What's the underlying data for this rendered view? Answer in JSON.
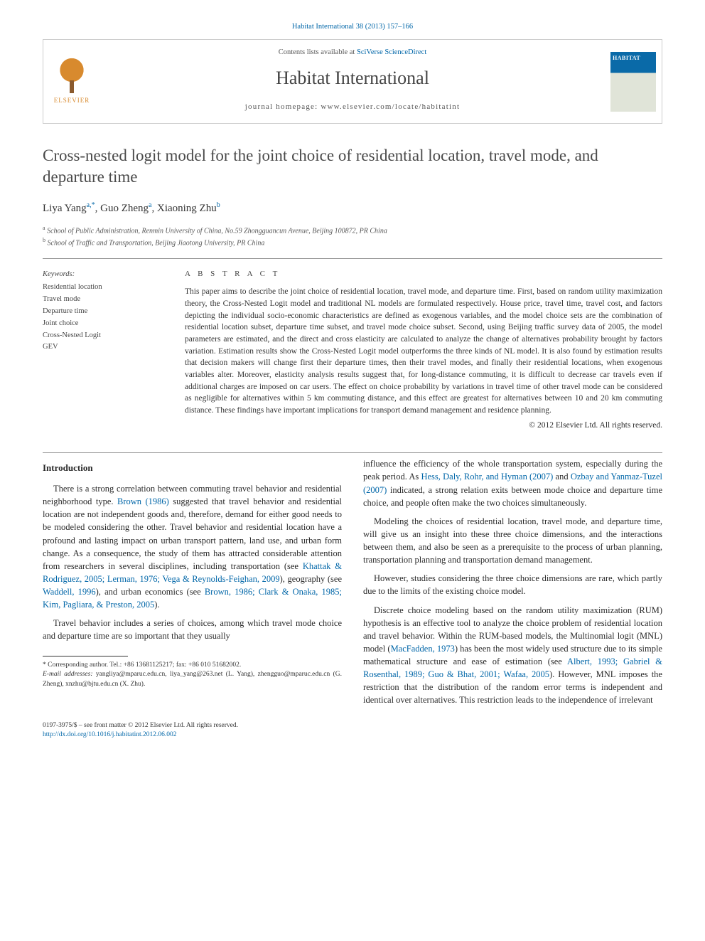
{
  "citation": "Habitat International 38 (2013) 157–166",
  "header": {
    "contents_prefix": "Contents lists available at ",
    "contents_link": "SciVerse ScienceDirect",
    "journal": "Habitat International",
    "homepage_label": "journal homepage: ",
    "homepage_url": "www.elsevier.com/locate/habitatint",
    "publisher": "ELSEVIER",
    "cover_title": "HABITAT"
  },
  "article": {
    "title": "Cross-nested logit model for the joint choice of residential location, travel mode, and departure time",
    "authors_html": "Liya Yang|a,*|, Guo Zheng|a|, Xiaoning Zhu|b|",
    "authors": [
      {
        "name": "Liya Yang",
        "sup": "a,*"
      },
      {
        "name": "Guo Zheng",
        "sup": "a"
      },
      {
        "name": "Xiaoning Zhu",
        "sup": "b"
      }
    ],
    "affiliations": [
      {
        "sup": "a",
        "text": "School of Public Administration, Renmin University of China, No.59 Zhongguancun Avenue, Beijing 100872, PR China"
      },
      {
        "sup": "b",
        "text": "School of Traffic and Transportation, Beijing Jiaotong University, PR China"
      }
    ]
  },
  "keywords": {
    "head": "Keywords:",
    "items": [
      "Residential location",
      "Travel mode",
      "Departure time",
      "Joint choice",
      "Cross-Nested Logit",
      "GEV"
    ]
  },
  "abstract": {
    "head": "A B S T R A C T",
    "text": "This paper aims to describe the joint choice of residential location, travel mode, and departure time. First, based on random utility maximization theory, the Cross-Nested Logit model and traditional NL models are formulated respectively. House price, travel time, travel cost, and factors depicting the individual socio-economic characteristics are defined as exogenous variables, and the model choice sets are the combination of residential location subset, departure time subset, and travel mode choice subset. Second, using Beijing traffic survey data of 2005, the model parameters are estimated, and the direct and cross elasticity are calculated to analyze the change of alternatives probability brought by factors variation. Estimation results show the Cross-Nested Logit model outperforms the three kinds of NL model. It is also found by estimation results that decision makers will change first their departure times, then their travel modes, and finally their residential locations, when exogenous variables alter. Moreover, elasticity analysis results suggest that, for long-distance commuting, it is difficult to decrease car travels even if additional charges are imposed on car users. The effect on choice probability by variations in travel time of other travel mode can be considered as negligible for alternatives within 5 km commuting distance, and this effect are greatest for alternatives between 10 and 20 km commuting distance. These findings have important implications for transport demand management and residence planning.",
    "copyright": "© 2012 Elsevier Ltd. All rights reserved."
  },
  "body": {
    "intro_head": "Introduction",
    "p1a": "There is a strong correlation between commuting travel behavior and residential neighborhood type. ",
    "p1_cite1": "Brown (1986)",
    "p1b": " suggested that travel behavior and residential location are not independent goods and, therefore, demand for either good needs to be modeled considering the other. Travel behavior and residential location have a profound and lasting impact on urban transport pattern, land use, and urban form change. As a consequence, the study of them has attracted considerable attention from researchers in several disciplines, including transportation (see ",
    "p1_cite2": "Khattak & Rodriguez, 2005; Lerman, 1976; Vega & Reynolds-Feighan, 2009",
    "p1c": "), geography (see ",
    "p1_cite3": "Waddell, 1996",
    "p1d": "), and urban economics (see ",
    "p1_cite4": "Brown, 1986; Clark & Onaka, 1985; Kim, Pagliara, & Preston, 2005",
    "p1e": ").",
    "p2": "Travel behavior includes a series of choices, among which travel mode choice and departure time are so important that they usually",
    "p3a": "influence the efficiency of the whole transportation system, especially during the peak period. As ",
    "p3_cite1": "Hess, Daly, Rohr, and Hyman (2007)",
    "p3b": " and ",
    "p3_cite2": "Ozbay and Yanmaz-Tuzel (2007)",
    "p3c": " indicated, a strong relation exits between mode choice and departure time choice, and people often make the two choices simultaneously.",
    "p4": "Modeling the choices of residential location, travel mode, and departure time, will give us an insight into these three choice dimensions, and the interactions between them, and also be seen as a prerequisite to the process of urban planning, transportation planning and transportation demand management.",
    "p5": "However, studies considering the three choice dimensions are rare, which partly due to the limits of the existing choice model.",
    "p6a": "Discrete choice modeling based on the random utility maximization (RUM) hypothesis is an effective tool to analyze the choice problem of residential location and travel behavior. Within the RUM-based models, the Multinomial logit (MNL) model (",
    "p6_cite1": "MacFadden, 1973",
    "p6b": ") has been the most widely used structure due to its simple mathematical structure and ease of estimation (see ",
    "p6_cite2": "Albert, 1993; Gabriel & Rosenthal, 1989; Guo & Bhat, 2001; Wafaa, 2005",
    "p6c": "). However, MNL imposes the restriction that the distribution of the random error terms is independent and identical over alternatives. This restriction leads to the independence of irrelevant"
  },
  "footnotes": {
    "corr_label": "* Corresponding author. Tel.: +86 13681125217; fax: +86 010 51682002.",
    "email_label": "E-mail addresses:",
    "emails": " yangliya@mparuc.edu.cn, liya_yang@263.net (L. Yang), zhengguo@mparuc.edu.cn (G. Zheng), xnzhu@bjtu.edu.cn (X. Zhu)."
  },
  "footer": {
    "issn_line": "0197-3975/$ – see front matter © 2012 Elsevier Ltd. All rights reserved.",
    "doi": "http://dx.doi.org/10.1016/j.habitatint.2012.06.002"
  }
}
